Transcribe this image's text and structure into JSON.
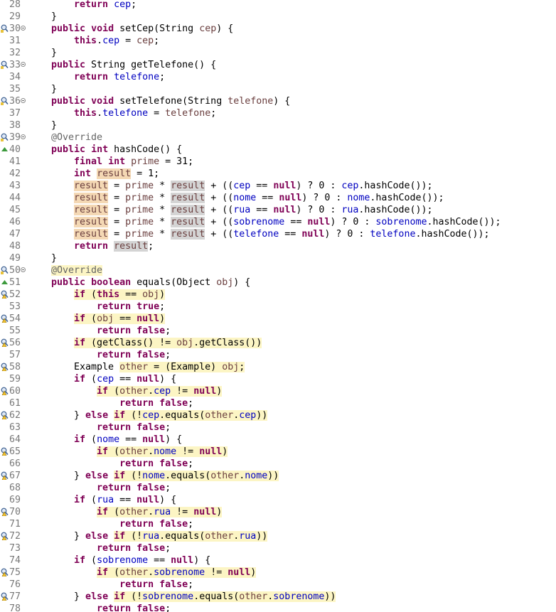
{
  "editor": {
    "first_line": 28,
    "lines": [
      {
        "n": "28",
        "marker": "",
        "fold": false,
        "html": "    <span class=\"kw\">return</span> <span class=\"fld\">cep</span>;"
      },
      {
        "n": "29",
        "marker": "",
        "fold": false,
        "html": "}"
      },
      {
        "n": "30",
        "marker": "search",
        "fold": true,
        "html": "<span class=\"kw\">public</span> <span class=\"kw\">void</span> setCep(String <span class=\"var\">cep</span>) {"
      },
      {
        "n": "31",
        "marker": "",
        "fold": false,
        "html": "    <span class=\"kw\">this</span>.<span class=\"fld\">cep</span> = <span class=\"var\">cep</span>;"
      },
      {
        "n": "32",
        "marker": "",
        "fold": false,
        "html": "}"
      },
      {
        "n": "33",
        "marker": "search",
        "fold": true,
        "html": "<span class=\"kw\">public</span> String getTelefone() {"
      },
      {
        "n": "34",
        "marker": "",
        "fold": false,
        "html": "    <span class=\"kw\">return</span> <span class=\"fld\">telefone</span>;"
      },
      {
        "n": "35",
        "marker": "",
        "fold": false,
        "html": "}"
      },
      {
        "n": "36",
        "marker": "search",
        "fold": true,
        "html": "<span class=\"kw\">public</span> <span class=\"kw\">void</span> setTelefone(String <span class=\"var\">telefone</span>) {"
      },
      {
        "n": "37",
        "marker": "",
        "fold": false,
        "html": "    <span class=\"kw\">this</span>.<span class=\"fld\">telefone</span> = <span class=\"var\">telefone</span>;"
      },
      {
        "n": "38",
        "marker": "",
        "fold": false,
        "html": "}"
      },
      {
        "n": "39",
        "marker": "search",
        "fold": true,
        "html": "<span class=\"ann\">@Override</span>"
      },
      {
        "n": "40",
        "marker": "override",
        "fold": false,
        "html": "<span class=\"kw\">public</span> <span class=\"kw\">int</span> hashCode() {"
      },
      {
        "n": "41",
        "marker": "",
        "fold": false,
        "html": "    <span class=\"kw\">final</span> <span class=\"kw\">int</span> <span class=\"var\">prime</span> = 31;"
      },
      {
        "n": "42",
        "marker": "",
        "fold": false,
        "html": "    <span class=\"kw\">int</span> <span class=\"var occ\">result</span> = 1;"
      },
      {
        "n": "43",
        "marker": "",
        "fold": false,
        "html": "    <span class=\"var occ\">result</span> = <span class=\"var\">prime</span> * <span class=\"var occr\">result</span> + ((<span class=\"fld\">cep</span> == <span class=\"kw\">null</span>) ? 0 : <span class=\"fld\">cep</span>.hashCode());"
      },
      {
        "n": "44",
        "marker": "",
        "fold": false,
        "html": "    <span class=\"var occ\">result</span> = <span class=\"var\">prime</span> * <span class=\"var occr\">result</span> + ((<span class=\"fld\">nome</span> == <span class=\"kw\">null</span>) ? 0 : <span class=\"fld\">nome</span>.hashCode());"
      },
      {
        "n": "45",
        "marker": "",
        "fold": false,
        "html": "    <span class=\"var occ\">result</span> = <span class=\"var\">prime</span> * <span class=\"var occr\">result</span> + ((<span class=\"fld\">rua</span> == <span class=\"kw\">null</span>) ? 0 : <span class=\"fld\">rua</span>.hashCode());"
      },
      {
        "n": "46",
        "marker": "",
        "fold": false,
        "html": "    <span class=\"var occ\">result</span> = <span class=\"var\">prime</span> * <span class=\"var occr\">result</span> + ((<span class=\"fld\">sobrenome</span> == <span class=\"kw\">null</span>) ? 0 : <span class=\"fld\">sobrenome</span>.hashCode());"
      },
      {
        "n": "47",
        "marker": "",
        "fold": false,
        "html": "    <span class=\"var occ\">result</span> = <span class=\"var\">prime</span> * <span class=\"var occr\">result</span> + ((<span class=\"fld\">telefone</span> == <span class=\"kw\">null</span>) ? 0 : <span class=\"fld\">telefone</span>.hashCode());"
      },
      {
        "n": "48",
        "marker": "",
        "fold": false,
        "html": "    <span class=\"kw\">return</span> <span class=\"var occr\">result</span>;"
      },
      {
        "n": "49",
        "marker": "",
        "fold": false,
        "html": "}"
      },
      {
        "n": "50",
        "marker": "search",
        "fold": true,
        "html": "<span class=\"ann hl\">@Override</span>"
      },
      {
        "n": "51",
        "marker": "override",
        "fold": false,
        "html": "<span class=\"kw\">public</span> <span class=\"kw\">boolean</span> equals(Object <span class=\"var\">obj</span>) {"
      },
      {
        "n": "52",
        "marker": "warn",
        "fold": false,
        "html": "    <span class=\"hl\"><span class=\"kw\">if</span> (<span class=\"kw\">this</span> == <span class=\"var\">obj</span>)</span>"
      },
      {
        "n": "53",
        "marker": "",
        "fold": false,
        "html": "        <span class=\"kw\">return</span> <span class=\"kw\">true</span>;"
      },
      {
        "n": "54",
        "marker": "warn",
        "fold": false,
        "html": "    <span class=\"hl\"><span class=\"kw\">if</span> (<span class=\"var\">obj</span> == <span class=\"kw\">null</span>)</span>"
      },
      {
        "n": "55",
        "marker": "",
        "fold": false,
        "html": "        <span class=\"kw\">return</span> <span class=\"kw\">false</span>;"
      },
      {
        "n": "56",
        "marker": "warn",
        "fold": false,
        "html": "    <span class=\"hl\"><span class=\"kw\">if</span> (getClass() != <span class=\"var\">obj</span>.getClass())</span>"
      },
      {
        "n": "57",
        "marker": "",
        "fold": false,
        "html": "        <span class=\"kw\">return</span> <span class=\"kw\">false</span>;"
      },
      {
        "n": "58",
        "marker": "warn",
        "fold": false,
        "html": "    Example <span class=\"hl\"><span class=\"var\">other</span> = (Example) <span class=\"var\">obj</span>;</span>"
      },
      {
        "n": "59",
        "marker": "",
        "fold": false,
        "html": "    <span class=\"kw\">if</span> (<span class=\"fld\">cep</span> == <span class=\"kw\">null</span>) {"
      },
      {
        "n": "60",
        "marker": "warn",
        "fold": false,
        "html": "        <span class=\"hl\"><span class=\"kw\">if</span> (<span class=\"var\">other</span>.<span class=\"fld\">cep</span> != <span class=\"kw\">null</span>)</span>"
      },
      {
        "n": "61",
        "marker": "",
        "fold": false,
        "html": "            <span class=\"kw\">return</span> <span class=\"kw\">false</span>;"
      },
      {
        "n": "62",
        "marker": "warn",
        "fold": false,
        "html": "    } <span class=\"kw\">else</span> <span class=\"hl\"><span class=\"kw\">if</span> (!<span class=\"fld\">cep</span>.equals(<span class=\"var\">other</span>.<span class=\"fld\">cep</span>))</span>"
      },
      {
        "n": "63",
        "marker": "",
        "fold": false,
        "html": "        <span class=\"kw\">return</span> <span class=\"kw\">false</span>;"
      },
      {
        "n": "64",
        "marker": "",
        "fold": false,
        "html": "    <span class=\"kw\">if</span> (<span class=\"fld\">nome</span> == <span class=\"kw\">null</span>) {"
      },
      {
        "n": "65",
        "marker": "warn",
        "fold": false,
        "html": "        <span class=\"hl\"><span class=\"kw\">if</span> (<span class=\"var\">other</span>.<span class=\"fld\">nome</span> != <span class=\"kw\">null</span>)</span>"
      },
      {
        "n": "66",
        "marker": "",
        "fold": false,
        "html": "            <span class=\"kw\">return</span> <span class=\"kw\">false</span>;"
      },
      {
        "n": "67",
        "marker": "warn",
        "fold": false,
        "html": "    } <span class=\"kw\">else</span> <span class=\"hl\"><span class=\"kw\">if</span> (!<span class=\"fld\">nome</span>.equals(<span class=\"var\">other</span>.<span class=\"fld\">nome</span>))</span>"
      },
      {
        "n": "68",
        "marker": "",
        "fold": false,
        "html": "        <span class=\"kw\">return</span> <span class=\"kw\">false</span>;"
      },
      {
        "n": "69",
        "marker": "",
        "fold": false,
        "html": "    <span class=\"kw\">if</span> (<span class=\"fld\">rua</span> == <span class=\"kw\">null</span>) {"
      },
      {
        "n": "70",
        "marker": "warn",
        "fold": false,
        "html": "        <span class=\"hl\"><span class=\"kw\">if</span> (<span class=\"var\">other</span>.<span class=\"fld\">rua</span> != <span class=\"kw\">null</span>)</span>"
      },
      {
        "n": "71",
        "marker": "",
        "fold": false,
        "html": "            <span class=\"kw\">return</span> <span class=\"kw\">false</span>;"
      },
      {
        "n": "72",
        "marker": "warn",
        "fold": false,
        "html": "    } <span class=\"kw\">else</span> <span class=\"hl\"><span class=\"kw\">if</span> (!<span class=\"fld\">rua</span>.equals(<span class=\"var\">other</span>.<span class=\"fld\">rua</span>))</span>"
      },
      {
        "n": "73",
        "marker": "",
        "fold": false,
        "html": "        <span class=\"kw\">return</span> <span class=\"kw\">false</span>;"
      },
      {
        "n": "74",
        "marker": "",
        "fold": false,
        "html": "    <span class=\"kw\">if</span> (<span class=\"fld\">sobrenome</span> == <span class=\"kw\">null</span>) {"
      },
      {
        "n": "75",
        "marker": "warn",
        "fold": false,
        "html": "        <span class=\"hl\"><span class=\"kw\">if</span> (<span class=\"var\">other</span>.<span class=\"fld\">sobrenome</span> != <span class=\"kw\">null</span>)</span>"
      },
      {
        "n": "76",
        "marker": "",
        "fold": false,
        "html": "            <span class=\"kw\">return</span> <span class=\"kw\">false</span>;"
      },
      {
        "n": "77",
        "marker": "warn",
        "fold": false,
        "html": "    } <span class=\"kw\">else</span> <span class=\"hl\"><span class=\"kw\">if</span> (!<span class=\"fld\">sobrenome</span>.equals(<span class=\"var\">other</span>.<span class=\"fld\">sobrenome</span>))</span>"
      },
      {
        "n": "78",
        "marker": "",
        "fold": false,
        "html": "        <span class=\"kw\">return</span> <span class=\"kw\">false</span>;"
      }
    ]
  }
}
